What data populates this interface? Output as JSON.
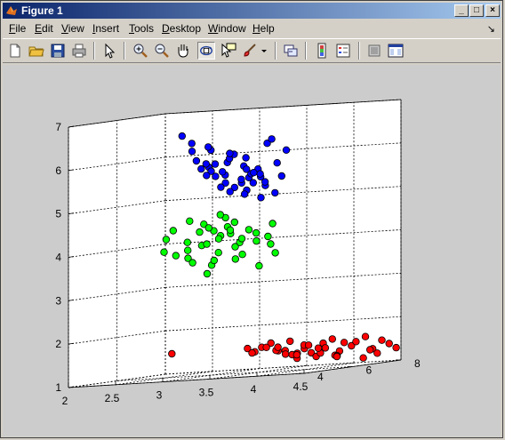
{
  "window": {
    "title": "Figure 1"
  },
  "title_buttons": [
    "_",
    "□",
    "×"
  ],
  "menu": [
    {
      "label": "File",
      "key": "F",
      "rest": "ile"
    },
    {
      "label": "Edit",
      "key": "E",
      "rest": "dit"
    },
    {
      "label": "View",
      "key": "V",
      "rest": "iew"
    },
    {
      "label": "Insert",
      "key": "I",
      "rest": "nsert"
    },
    {
      "label": "Tools",
      "key": "T",
      "rest": "ools"
    },
    {
      "label": "Desktop",
      "key": "D",
      "rest": "esktop"
    },
    {
      "label": "Window",
      "key": "W",
      "rest": "indow"
    },
    {
      "label": "Help",
      "key": "H",
      "rest": "elp"
    }
  ],
  "toolbar": [
    "new-figure-icon",
    "open-file-icon",
    "save-icon",
    "print-icon",
    "edit-plot-icon",
    "zoom-in-icon",
    "zoom-out-icon",
    "pan-icon",
    "rotate-3d-icon",
    "data-cursor-icon",
    "brush-icon",
    "link-plot-icon",
    "colorbar-icon",
    "legend-icon",
    "hide-plot-tools-icon",
    "show-plot-tools-icon"
  ],
  "chart_data": {
    "type": "scatter",
    "axes": {
      "x": {
        "lim": [
          2,
          4.5
        ],
        "ticks": [
          2,
          2.5,
          3,
          3.5,
          4,
          4.5
        ]
      },
      "y": {
        "lim": [
          4,
          8
        ],
        "ticks": [
          4,
          6,
          8
        ]
      },
      "z": {
        "lim": [
          1,
          7
        ],
        "ticks": [
          1,
          2,
          3,
          4,
          5,
          6,
          7
        ]
      }
    },
    "grid": true,
    "series": [
      {
        "color": "#0000ff",
        "points": [
          [
            3.0,
            5.2,
            6.4
          ],
          [
            3.1,
            5.6,
            6.2
          ],
          [
            3.2,
            5.1,
            6.3
          ],
          [
            3.0,
            5.9,
            5.8
          ],
          [
            3.3,
            5.5,
            5.9
          ],
          [
            3.4,
            5.2,
            6.0
          ],
          [
            3.2,
            5.8,
            5.6
          ],
          [
            3.5,
            5.4,
            5.8
          ],
          [
            3.3,
            5.0,
            5.9
          ],
          [
            3.1,
            6.2,
            5.4
          ],
          [
            3.4,
            6.0,
            5.5
          ],
          [
            3.6,
            5.6,
            5.7
          ],
          [
            3.2,
            5.4,
            5.6
          ],
          [
            3.5,
            6.1,
            5.5
          ],
          [
            3.0,
            6.4,
            5.3
          ],
          [
            3.4,
            5.7,
            5.4
          ],
          [
            3.3,
            6.3,
            5.2
          ],
          [
            3.6,
            5.9,
            5.3
          ],
          [
            3.7,
            5.3,
            5.6
          ],
          [
            3.1,
            5.0,
            6.0
          ],
          [
            3.5,
            5.0,
            6.1
          ],
          [
            3.8,
            5.8,
            5.5
          ],
          [
            3.0,
            6.0,
            5.7
          ],
          [
            3.2,
            6.6,
            5.1
          ],
          [
            3.4,
            6.5,
            5.0
          ],
          [
            3.6,
            6.3,
            5.1
          ],
          [
            3.3,
            5.3,
            5.7
          ],
          [
            3.5,
            5.7,
            5.6
          ],
          [
            2.9,
            5.6,
            6.2
          ],
          [
            3.7,
            6.0,
            5.8
          ],
          [
            3.1,
            5.4,
            5.9
          ],
          [
            3.3,
            5.8,
            5.3
          ],
          [
            3.9,
            5.6,
            6.1
          ],
          [
            3.8,
            5.2,
            6.3
          ],
          [
            3.0,
            4.8,
            6.6
          ],
          [
            3.6,
            5.4,
            5.4
          ],
          [
            3.2,
            6.0,
            5.2
          ],
          [
            3.4,
            6.2,
            5.6
          ],
          [
            3.5,
            5.3,
            5.5
          ],
          [
            3.1,
            5.2,
            5.8
          ],
          [
            3.9,
            5.0,
            6.4
          ],
          [
            3.3,
            5.6,
            6.1
          ],
          [
            3.6,
            5.1,
            6.0
          ],
          [
            3.4,
            5.9,
            5.7
          ],
          [
            2.9,
            6.2,
            5.6
          ],
          [
            3.7,
            5.5,
            5.4
          ]
        ]
      },
      {
        "color": "#00ff00",
        "points": [
          [
            2.8,
            5.8,
            4.1
          ],
          [
            2.7,
            6.2,
            3.9
          ],
          [
            2.9,
            6.0,
            4.0
          ],
          [
            3.0,
            6.3,
            3.8
          ],
          [
            2.6,
            6.6,
            3.7
          ],
          [
            2.8,
            6.8,
            3.5
          ],
          [
            3.1,
            6.0,
            4.2
          ],
          [
            3.2,
            6.4,
            4.0
          ],
          [
            2.7,
            5.6,
            4.4
          ],
          [
            3.3,
            6.1,
            4.1
          ],
          [
            2.9,
            6.5,
            4.3
          ],
          [
            3.0,
            5.7,
            4.5
          ],
          [
            3.1,
            6.6,
            3.9
          ],
          [
            2.8,
            6.9,
            3.6
          ],
          [
            3.2,
            5.9,
            4.4
          ],
          [
            3.4,
            6.3,
            4.2
          ],
          [
            2.6,
            6.1,
            3.8
          ],
          [
            3.0,
            7.0,
            3.6
          ],
          [
            3.3,
            6.7,
            4.0
          ],
          [
            2.9,
            5.5,
            4.6
          ],
          [
            3.1,
            6.2,
            4.6
          ],
          [
            2.7,
            6.4,
            3.6
          ],
          [
            3.4,
            6.0,
            4.3
          ],
          [
            3.0,
            6.8,
            4.2
          ],
          [
            3.2,
            5.6,
            4.7
          ],
          [
            2.8,
            6.3,
            4.3
          ],
          [
            3.5,
            6.4,
            4.1
          ],
          [
            3.1,
            6.9,
            3.7
          ],
          [
            2.9,
            6.7,
            4.1
          ],
          [
            3.3,
            5.8,
            4.5
          ],
          [
            2.5,
            6.0,
            3.9
          ],
          [
            3.6,
            6.2,
            4.4
          ],
          [
            2.7,
            7.0,
            3.3
          ],
          [
            3.2,
            7.2,
            3.4
          ],
          [
            3.4,
            6.9,
            3.9
          ],
          [
            3.0,
            5.9,
            4.4
          ],
          [
            2.8,
            6.6,
            4.0
          ],
          [
            3.5,
            6.7,
            3.7
          ],
          [
            3.1,
            6.4,
            4.3
          ],
          [
            2.6,
            5.7,
            4.2
          ]
        ]
      },
      {
        "color": "#ff0000",
        "points": [
          [
            3.0,
            7.5,
            1.5
          ],
          [
            3.3,
            7.6,
            1.4
          ],
          [
            3.6,
            7.8,
            1.3
          ],
          [
            3.2,
            7.9,
            1.4
          ],
          [
            3.4,
            7.7,
            1.6
          ],
          [
            3.5,
            7.4,
            1.3
          ],
          [
            3.7,
            7.9,
            1.5
          ],
          [
            3.8,
            7.6,
            1.4
          ],
          [
            3.1,
            7.7,
            1.5
          ],
          [
            3.4,
            7.5,
            1.4
          ],
          [
            3.9,
            7.8,
            1.3
          ],
          [
            4.0,
            7.9,
            1.4
          ],
          [
            3.6,
            8.0,
            1.2
          ],
          [
            3.3,
            7.3,
            1.6
          ],
          [
            4.1,
            7.7,
            1.5
          ],
          [
            3.8,
            7.4,
            1.3
          ],
          [
            3.5,
            7.9,
            1.4
          ],
          [
            3.2,
            7.5,
            1.5
          ],
          [
            4.2,
            8.0,
            1.3
          ],
          [
            3.9,
            7.5,
            1.6
          ],
          [
            3.7,
            7.7,
            1.4
          ],
          [
            4.3,
            7.8,
            1.2
          ],
          [
            3.4,
            8.0,
            1.3
          ],
          [
            3.6,
            7.5,
            1.5
          ],
          [
            4.0,
            7.6,
            1.5
          ],
          [
            3.8,
            8.0,
            1.2
          ],
          [
            4.4,
            7.9,
            1.4
          ],
          [
            3.5,
            7.6,
            1.2
          ],
          [
            4.2,
            7.7,
            1.6
          ],
          [
            3.0,
            7.8,
            1.4
          ],
          [
            3.3,
            7.9,
            1.3
          ],
          [
            4.1,
            8.0,
            1.1
          ],
          [
            3.9,
            7.7,
            1.2
          ],
          [
            3.7,
            7.3,
            1.5
          ],
          [
            4.4,
            7.6,
            1.5
          ],
          [
            3.1,
            7.3,
            1.4
          ],
          [
            4.5,
            7.8,
            1.3
          ],
          [
            3.6,
            7.2,
            1.3
          ],
          [
            4.3,
            7.5,
            1.3
          ],
          [
            2.3,
            7.1,
            1.5
          ],
          [
            3.4,
            7.2,
            1.5
          ],
          [
            4.0,
            7.3,
            1.2
          ]
        ]
      }
    ]
  }
}
